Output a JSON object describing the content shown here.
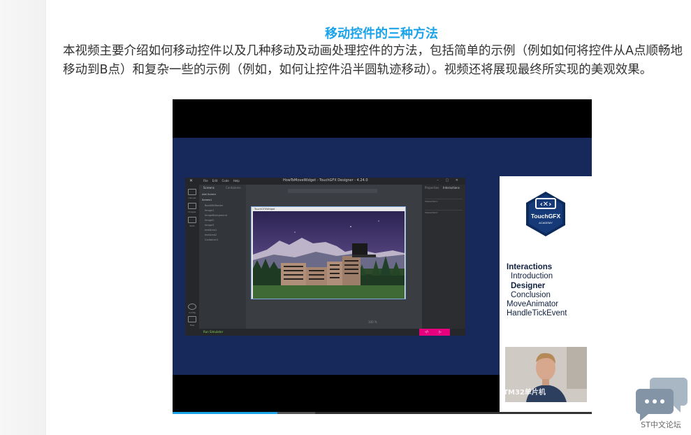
{
  "article": {
    "title": "移动控件的三种方法",
    "body": "本视频主要介绍如何移动控件以及几种移动及动画处理控件的方法，包括简单的示例（例如如何将控件从A点顺畅地移动到B点）和复杂一些的示例（例如，如何让控件沿半圆轨迹移动）。视频还将展现最终所实现的美观效果。"
  },
  "video": {
    "progress_fraction": 0.25,
    "buffered_fraction": 0.34,
    "designer": {
      "window_title": "HowToMoveWidget - TouchGFX Designer - 4.24.0",
      "menu": [
        "File",
        "Edit",
        "Code",
        "Help"
      ],
      "left_nav": [
        "Canvas",
        "Images",
        "Texts",
        "Config",
        "Files"
      ],
      "screens_tabs": [
        "Screens",
        "Containers"
      ],
      "add_screen": "Add Screen",
      "screen_name": "Screen1",
      "widgets": [
        "BoxWithBorder",
        "Image1",
        "ImageBackground",
        "Image2",
        "Image3",
        "textArea1",
        "textArea2",
        "Container1"
      ],
      "right_tabs": [
        "Properties",
        "Interactions"
      ],
      "interactions": [
        "Interaction1",
        "Interaction2"
      ],
      "simulator_title": "TouchGFXWidget",
      "run_simulator": "Run Simulator",
      "zoom": "100 %",
      "colors": {
        "accent_pink": "#e5007e",
        "run_green": "#8ad34b"
      }
    },
    "academy": {
      "brand": "TouchGFX",
      "sub": "ACADEMY",
      "toc": [
        {
          "label": "Interactions",
          "bold": true,
          "indent": false
        },
        {
          "label": "Introduction",
          "bold": false,
          "indent": true
        },
        {
          "label": "Designer",
          "bold": true,
          "indent": true
        },
        {
          "label": "Conclusion",
          "bold": false,
          "indent": true
        },
        {
          "label": "MoveAnimator",
          "bold": false,
          "indent": false
        },
        {
          "label": "HandleTickEvent",
          "bold": false,
          "indent": false
        }
      ],
      "webcam_watermark": "STM32单片机"
    }
  },
  "forum": {
    "label": "ST中文论坛",
    "icon": "chat-bubbles-icon"
  },
  "colors": {
    "title_blue": "#1aa3e8",
    "video_bg_navy": "#17295a"
  }
}
